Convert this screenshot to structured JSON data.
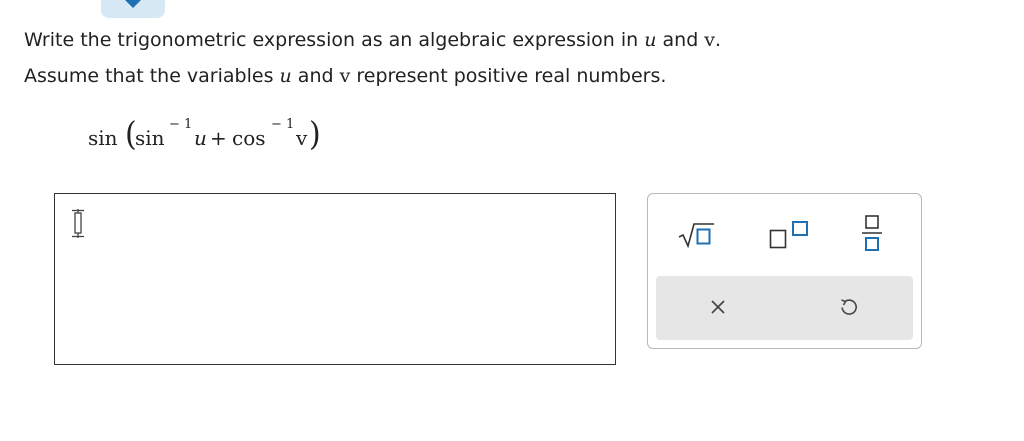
{
  "question": {
    "line1_before": "Write the trigonometric expression as an algebraic expression in ",
    "var_u": "u",
    "line1_and": " and ",
    "var_v": "v",
    "line1_end": ".",
    "line2_before": "Assume that the variables ",
    "line2_and": " and ",
    "line2_end": " represent positive real numbers."
  },
  "expression": {
    "sin_outer": "sin",
    "open_paren": "(",
    "sin_inner": "sin",
    "exp1": "− 1",
    "u": "u",
    "plus": "+",
    "cos": "cos",
    "exp2": "− 1",
    "v": "v",
    "close_paren": ")"
  },
  "answer": {
    "value": ""
  },
  "keypad": {
    "icons": [
      "square-root-icon",
      "superscript-icon",
      "fraction-icon",
      "clear-icon",
      "undo-icon"
    ],
    "accent_color": "#1f6fb2",
    "bar_color": "#e6e6e6"
  }
}
